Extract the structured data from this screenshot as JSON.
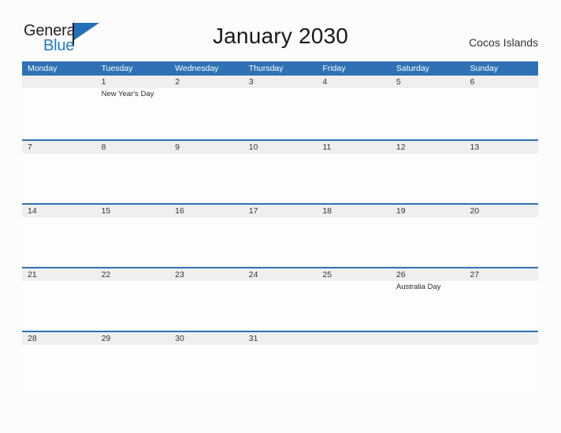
{
  "brand": {
    "name_part1": "General",
    "name_part2": "Blue",
    "flag_icon": "flag-icon",
    "color_dark": "#231f20",
    "color_blue": "#1f7ac7"
  },
  "header": {
    "title": "January 2030",
    "locale": "Cocos Islands"
  },
  "theme": {
    "header_blue": "#2e72b5",
    "band_gray": "#efefef",
    "page_background": "#fcfcfc",
    "text_color": "#333333"
  },
  "calendar": {
    "weekdays": [
      "Monday",
      "Tuesday",
      "Wednesday",
      "Thursday",
      "Friday",
      "Saturday",
      "Sunday"
    ],
    "weeks": [
      [
        {
          "date": "",
          "event": ""
        },
        {
          "date": "1",
          "event": "New Year's Day"
        },
        {
          "date": "2",
          "event": ""
        },
        {
          "date": "3",
          "event": ""
        },
        {
          "date": "4",
          "event": ""
        },
        {
          "date": "5",
          "event": ""
        },
        {
          "date": "6",
          "event": ""
        }
      ],
      [
        {
          "date": "7",
          "event": ""
        },
        {
          "date": "8",
          "event": ""
        },
        {
          "date": "9",
          "event": ""
        },
        {
          "date": "10",
          "event": ""
        },
        {
          "date": "11",
          "event": ""
        },
        {
          "date": "12",
          "event": ""
        },
        {
          "date": "13",
          "event": ""
        }
      ],
      [
        {
          "date": "14",
          "event": ""
        },
        {
          "date": "15",
          "event": ""
        },
        {
          "date": "16",
          "event": ""
        },
        {
          "date": "17",
          "event": ""
        },
        {
          "date": "18",
          "event": ""
        },
        {
          "date": "19",
          "event": ""
        },
        {
          "date": "20",
          "event": ""
        }
      ],
      [
        {
          "date": "21",
          "event": ""
        },
        {
          "date": "22",
          "event": ""
        },
        {
          "date": "23",
          "event": ""
        },
        {
          "date": "24",
          "event": ""
        },
        {
          "date": "25",
          "event": ""
        },
        {
          "date": "26",
          "event": "Australia Day"
        },
        {
          "date": "27",
          "event": ""
        }
      ],
      [
        {
          "date": "28",
          "event": ""
        },
        {
          "date": "29",
          "event": ""
        },
        {
          "date": "30",
          "event": ""
        },
        {
          "date": "31",
          "event": ""
        },
        {
          "date": "",
          "event": ""
        },
        {
          "date": "",
          "event": ""
        },
        {
          "date": "",
          "event": ""
        }
      ]
    ]
  }
}
